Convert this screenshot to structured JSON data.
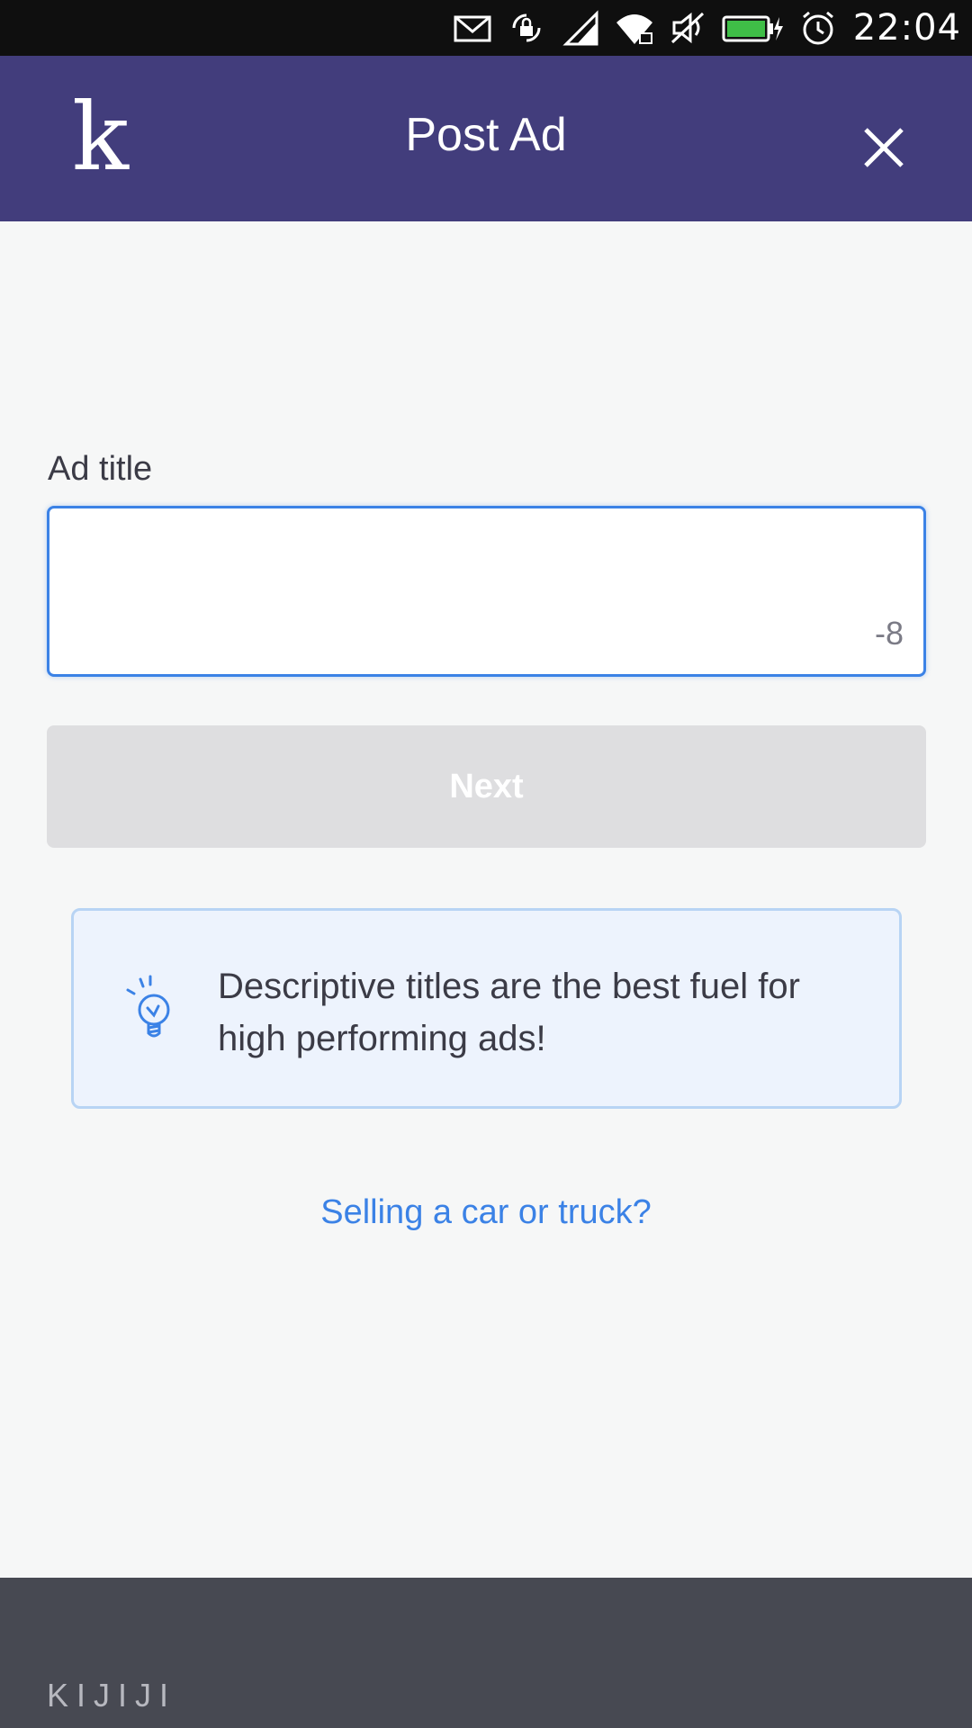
{
  "status_bar": {
    "time": "22:04",
    "icons": [
      "mail-icon",
      "screen-rotation-lock-icon",
      "cell-signal-icon",
      "wifi-icon",
      "mute-icon",
      "battery-charging-icon",
      "alarm-icon"
    ]
  },
  "header": {
    "logo": "k",
    "title": "Post Ad",
    "close_icon": "close-icon"
  },
  "form": {
    "field_label": "Ad title",
    "input_value": "",
    "char_counter": "-8",
    "next_label": "Next"
  },
  "tip": {
    "icon": "lightbulb-icon",
    "text": "Descriptive titles are the best fuel for high performing ads!"
  },
  "link": {
    "label": "Selling a car or truck?"
  },
  "footer": {
    "brand": "KIJIJI"
  },
  "colors": {
    "header_bg": "#423d7c",
    "accent": "#3b82e6",
    "footer_bg": "#474952",
    "tip_bg": "#edf3fd"
  }
}
